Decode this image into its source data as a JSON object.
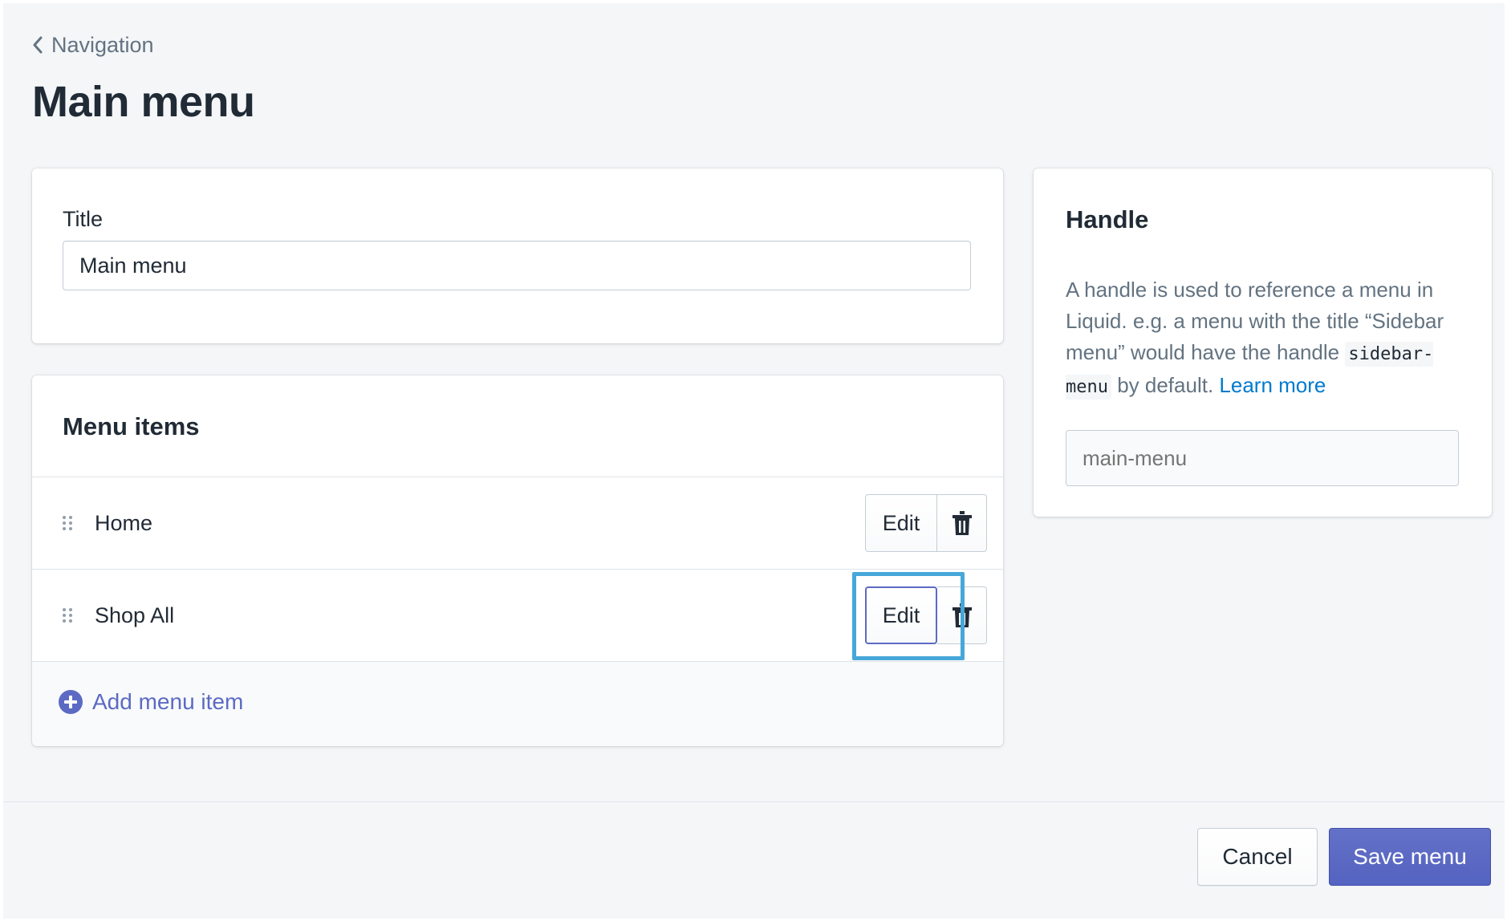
{
  "breadcrumb": {
    "label": "Navigation"
  },
  "page": {
    "title": "Main menu"
  },
  "title_card": {
    "label": "Title",
    "value": "Main menu"
  },
  "menu_items": {
    "heading": "Menu items",
    "items": [
      {
        "label": "Home",
        "edit_label": "Edit"
      },
      {
        "label": "Shop All",
        "edit_label": "Edit"
      }
    ],
    "add_label": "Add menu item"
  },
  "handle": {
    "heading": "Handle",
    "description_part1": "A handle is used to reference a menu in Liquid. e.g. a menu with the title “Sidebar menu” would have the handle ",
    "code_example": "sidebar-menu",
    "description_part2": " by default. ",
    "learn_more": "Learn more",
    "placeholder": "main-menu"
  },
  "footer": {
    "cancel_label": "Cancel",
    "save_label": "Save menu"
  },
  "colors": {
    "accent": "#5c6ac4",
    "link": "#007ace",
    "highlight": "#47a7d9",
    "background": "#f4f6f8"
  },
  "icons": {
    "back": "chevron-left-icon",
    "drag": "drag-handle-icon",
    "delete": "trash-icon",
    "add": "circle-plus-icon"
  }
}
